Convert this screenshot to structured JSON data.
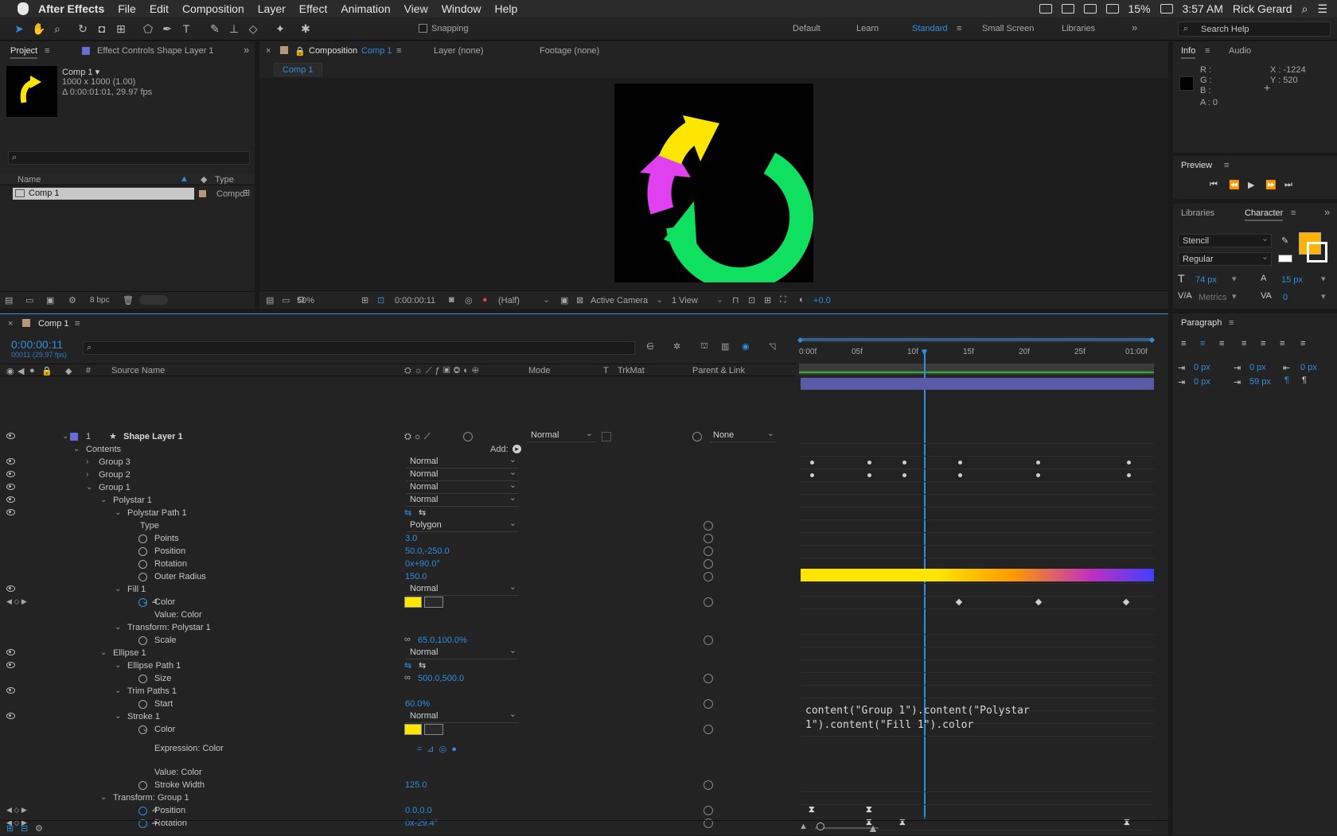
{
  "menubar": {
    "app": "After Effects",
    "items": [
      "File",
      "Edit",
      "Composition",
      "Layer",
      "Effect",
      "Animation",
      "View",
      "Window",
      "Help"
    ],
    "battery": "15%",
    "time": "3:57 AM",
    "user": "Rick Gerard"
  },
  "toolbar": {
    "snapping": "Snapping",
    "workspaces": [
      "Default",
      "Learn",
      "Standard",
      "Small Screen",
      "Libraries"
    ],
    "active_workspace": "Standard",
    "search_placeholder": "Search Help"
  },
  "project": {
    "tab": "Project",
    "tab2": "Effect Controls Shape Layer 1",
    "comp_name": "Comp 1 ▾",
    "comp_dims": "1000 x 1000 (1.00)",
    "comp_duration": "Δ 0:00:01:01, 29.97 fps",
    "col_name": "Name",
    "col_type": "Type",
    "item_name": "Comp 1",
    "item_type": "Compo",
    "bpc": "8 bpc"
  },
  "viewer": {
    "tab": "Composition",
    "tab_comp": "Comp 1",
    "layer_tab": "Layer (none)",
    "footage_tab": "Footage (none)",
    "subtab": "Comp 1",
    "zoom": "50%",
    "timecode": "0:00:00:11",
    "resolution": "(Half)",
    "camera": "Active Camera",
    "views": "1 View",
    "exposure": "+0.0"
  },
  "info": {
    "tab": "Info",
    "tab2": "Audio",
    "r": "R :",
    "g": "G :",
    "b": "B :",
    "a": "A :  0",
    "x": "X : -1224",
    "y": "Y :  520"
  },
  "preview": {
    "title": "Preview"
  },
  "character": {
    "tab1": "Libraries",
    "tab2": "Character",
    "font": "Stencil",
    "style": "Regular",
    "size": "74 px",
    "leading": "15 px",
    "kerning": "Metrics",
    "tracking": "0",
    "fill_color": "#ffb300"
  },
  "paragraph": {
    "title": "Paragraph",
    "indent1": "0 px",
    "indent2": "0 px",
    "indent3": "0 px",
    "space1": "0 px",
    "space2": "59 px"
  },
  "timeline": {
    "tab": "Comp 1",
    "timecode": "0:00:00:11",
    "frame": "00011 (29.97 fps)",
    "col_num": "#",
    "col_source": "Source Name",
    "col_mode": "Mode",
    "col_t": "T",
    "col_trkmat": "TrkMat",
    "col_parent": "Parent & Link",
    "ruler": [
      "0:00f",
      "05f",
      "10f",
      "15f",
      "20f",
      "25f",
      "01:00f"
    ],
    "layer_num": "1",
    "layer_name": "Shape Layer 1",
    "layer_mode": "Normal",
    "layer_parent": "None",
    "contents": "Contents",
    "add": "Add:",
    "group3": "Group 3",
    "group2": "Group 2",
    "group1": "Group 1",
    "polystar1": "Polystar 1",
    "polystar_path": "Polystar Path 1",
    "type_label": "Type",
    "type_value": "Polygon",
    "points_label": "Points",
    "points_value": "3.0",
    "position_label": "Position",
    "position_value": "50.0,-250.0",
    "rotation_label": "Rotation",
    "rotation_value": "0x+90.0°",
    "outer_radius_label": "Outer Radius",
    "outer_radius_value": "150.0",
    "fill1": "Fill 1",
    "color_label": "Color",
    "value_color": "Value: Color",
    "transform_polystar": "Transform: Polystar 1",
    "scale_label": "Scale",
    "scale_value": "65.0,100.0%",
    "ellipse1": "Ellipse 1",
    "ellipse_path": "Ellipse Path 1",
    "size_label": "Size",
    "size_value": "500.0,500.0",
    "trim_paths": "Trim Paths 1",
    "start_label": "Start",
    "start_value": "60.0%",
    "stroke1": "Stroke 1",
    "expression_color": "Expression: Color",
    "stroke_width_label": "Stroke Width",
    "stroke_width_value": "125.0",
    "transform_group": "Transform: Group 1",
    "t_position_value": "0.0,0.0",
    "t_rotation_value": "0x-29.4°",
    "expression_text_1": "content(\"Group 1\").content(\"Polystar",
    "expression_text_2": "1\").content(\"Fill 1\").color",
    "normal": "Normal"
  }
}
